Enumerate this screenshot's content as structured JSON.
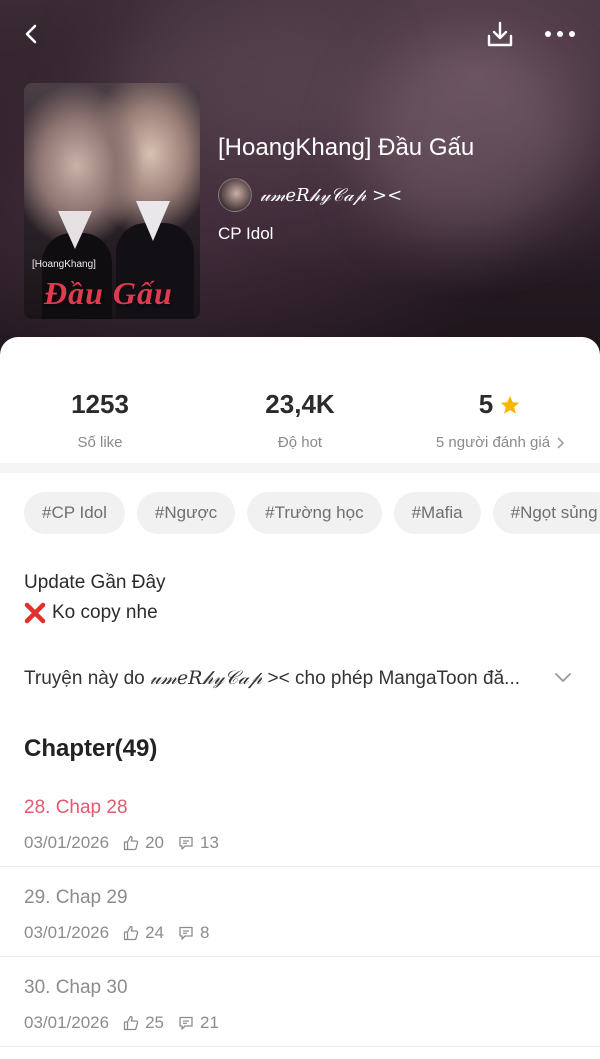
{
  "header": {
    "icons": {
      "back": "back-arrow-icon",
      "download": "download-icon",
      "more": "more-icon"
    }
  },
  "cover": {
    "small_text": "[HoangKhang]",
    "art_title": "Đầu Gấu"
  },
  "story": {
    "title": "[HoangKhang] Đầu Gấu",
    "author": "𝓊𝓂𝑒𝑅𝒽𝓎𝒞𝒶𝓅 ><",
    "genre": "CP Idol"
  },
  "stats": {
    "likes": {
      "value": "1253",
      "label": "Số like"
    },
    "hot": {
      "value": "23,4K",
      "label": "Độ hot"
    },
    "rating": {
      "value": "5",
      "label": "5 người đánh giá"
    }
  },
  "tags": [
    "#CP Idol",
    "#Ngược",
    "#Trường học",
    "#Mafia",
    "#Ngọt sủng"
  ],
  "update": {
    "title": "Update Gần Đây",
    "note": "Ko copy nhe"
  },
  "permission": {
    "prefix": "Truyện này do ",
    "author": "𝓊𝓂𝑒𝑅𝒽𝓎𝒞𝒶𝓅",
    "suffix": " >< cho phép MangaToon đă..."
  },
  "chapters": {
    "heading": "Chapter(49)",
    "items": [
      {
        "title": "28. Chap 28",
        "date": "03/01/2026",
        "likes": "20",
        "comments": "13"
      },
      {
        "title": "29. Chap 29",
        "date": "03/01/2026",
        "likes": "24",
        "comments": "8"
      },
      {
        "title": "30. Chap 30",
        "date": "03/01/2026",
        "likes": "25",
        "comments": "21"
      }
    ]
  },
  "colors": {
    "accent": "#e05a70",
    "star": "#f5b800",
    "cover_title": "#e03a4f"
  }
}
